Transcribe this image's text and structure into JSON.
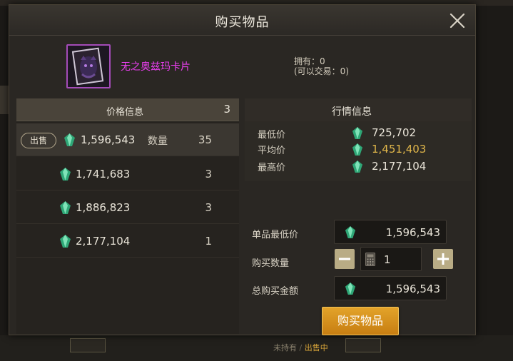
{
  "dialog": {
    "title": "购买物品"
  },
  "item": {
    "name": "无之奥兹玛卡片",
    "owned": "拥有：0",
    "tradable": "(可以交易：0)"
  },
  "price_list": {
    "header": "价格信息",
    "header_count": "3",
    "qty_label": "数量",
    "sell_badge": "出售",
    "rows": [
      {
        "price": "1,596,543",
        "qty": "35"
      },
      {
        "price": "1,741,683",
        "qty": "3"
      },
      {
        "price": "1,886,823",
        "qty": "3"
      },
      {
        "price": "2,177,104",
        "qty": "1"
      }
    ]
  },
  "market": {
    "header": "行情信息",
    "min_label": "最低价",
    "min_value": "725,702",
    "avg_label": "平均价",
    "avg_value": "1,451,403",
    "max_label": "最高价",
    "max_value": "2,177,104"
  },
  "purchase": {
    "unit_min_label": "单品最低价",
    "unit_min_value": "1,596,543",
    "quantity_label": "购买数量",
    "quantity_value": "1",
    "total_label": "总购买金额",
    "total_value": "1,596,543",
    "buy_button": "购买物品"
  },
  "background": {
    "hint_not_owned": "未持有",
    "hint_sep": "/",
    "hint_selling": "出售中"
  },
  "colors": {
    "item_name": "#ea3ff0",
    "avg_price": "#e0b64a",
    "buy_button": "#d8921c",
    "gem": "#3fc28a"
  },
  "icons": {
    "close": "close-icon",
    "gem": "gem-currency-icon",
    "minus": "minus-icon",
    "plus": "plus-icon",
    "calculator": "calculator-icon"
  }
}
